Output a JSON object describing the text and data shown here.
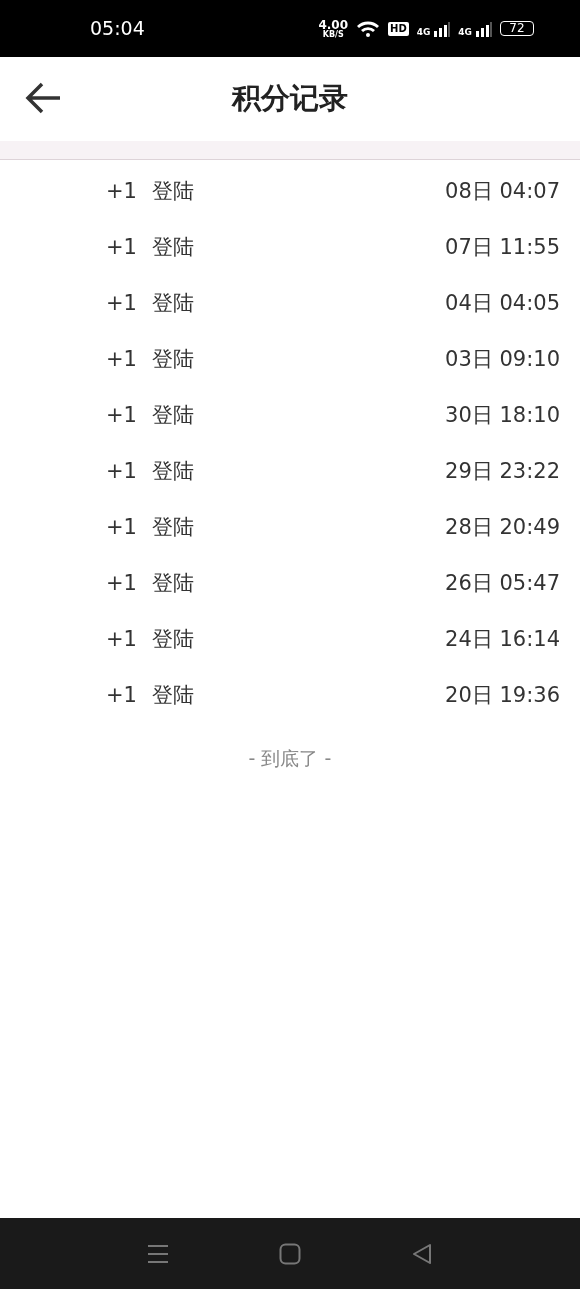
{
  "status_bar": {
    "time": "05:04",
    "speed": "4.00",
    "speed_unit": "KB/S",
    "hd": "HD",
    "networks": [
      "4G",
      "4G"
    ],
    "battery": "72"
  },
  "header": {
    "title": "积分记录"
  },
  "records": [
    {
      "points": "+1",
      "action": "登陆",
      "time": "08日 04:07"
    },
    {
      "points": "+1",
      "action": "登陆",
      "time": "07日 11:55"
    },
    {
      "points": "+1",
      "action": "登陆",
      "time": "04日 04:05"
    },
    {
      "points": "+1",
      "action": "登陆",
      "time": "03日 09:10"
    },
    {
      "points": "+1",
      "action": "登陆",
      "time": "30日 18:10"
    },
    {
      "points": "+1",
      "action": "登陆",
      "time": "29日 23:22"
    },
    {
      "points": "+1",
      "action": "登陆",
      "time": "28日 20:49"
    },
    {
      "points": "+1",
      "action": "登陆",
      "time": "26日 05:47"
    },
    {
      "points": "+1",
      "action": "登陆",
      "time": "24日 16:14"
    },
    {
      "points": "+1",
      "action": "登陆",
      "time": "20日 19:36"
    }
  ],
  "end_note": "- 到底了 -"
}
